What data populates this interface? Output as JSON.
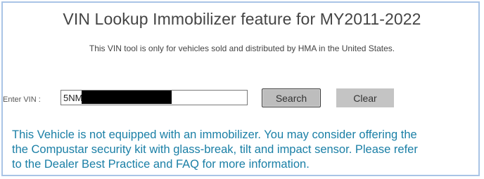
{
  "page": {
    "title": "VIN Lookup Immobilizer feature for MY2011-2022",
    "subtitle": "This VIN tool is only for vehicles sold and distributed by HMA in the United States."
  },
  "form": {
    "vin_label": "Enter VIN :",
    "vin_value": "5NM",
    "search_label": "Search",
    "clear_label": "Clear"
  },
  "result": {
    "line1": "This Vehicle is not equipped with an immobilizer. You may consider offering the",
    "line2": "the Compustar security kit with glass-break, tilt and impact sensor. Please refer",
    "line3": "to the Dealer Best Practice and FAQ for more information."
  },
  "colors": {
    "message_text": "#1a7fa6",
    "frame_border": "#a9c4e6"
  }
}
